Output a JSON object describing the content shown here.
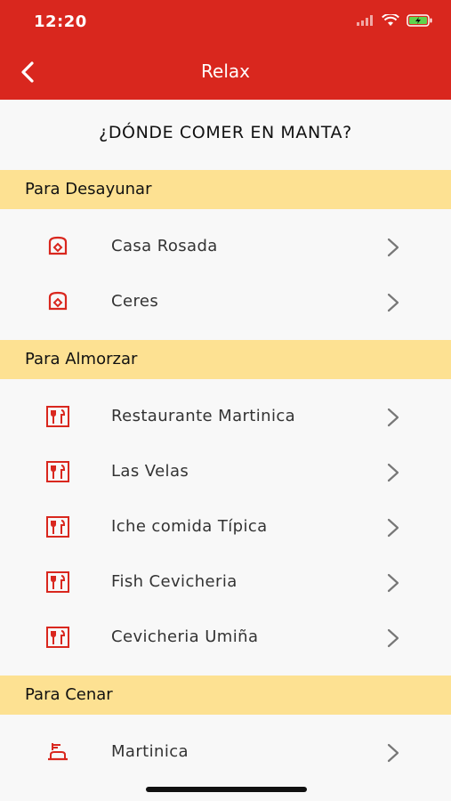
{
  "status_bar": {
    "time": "12:20"
  },
  "nav": {
    "title": "Relax"
  },
  "page": {
    "title": "¿DÓNDE COMER EN MANTA?"
  },
  "sections": [
    {
      "title": "Para Desayunar",
      "items": [
        {
          "label": "Casa Rosada",
          "icon": "toaster-icon"
        },
        {
          "label": "Ceres",
          "icon": "toaster-icon"
        }
      ]
    },
    {
      "title": "Para Almorzar",
      "items": [
        {
          "label": "Restaurante Martinica",
          "icon": "restaurant-icon"
        },
        {
          "label": "Las Velas",
          "icon": "restaurant-icon"
        },
        {
          "label": "Iche comida Típica",
          "icon": "restaurant-icon"
        },
        {
          "label": "Fish Cevicheria",
          "icon": "restaurant-icon"
        },
        {
          "label": "Cevicheria Umiña",
          "icon": "restaurant-icon"
        }
      ]
    },
    {
      "title": "Para Cenar",
      "items": [
        {
          "label": "Martinica",
          "icon": "dinner-plate-icon"
        }
      ]
    }
  ],
  "colors": {
    "header": "#d9271e",
    "section_bg": "#fde192",
    "icon": "#d9271e"
  }
}
